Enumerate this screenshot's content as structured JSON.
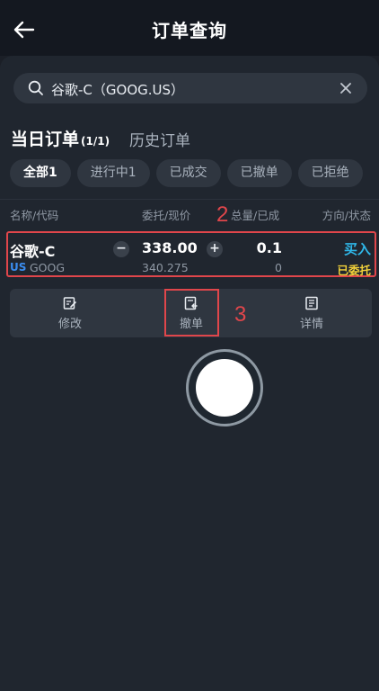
{
  "header": {
    "title": "订单查询"
  },
  "search": {
    "value": "谷歌-C（GOOG.US）"
  },
  "tabs": {
    "today_label": "当日订单",
    "today_count": "(1/1)",
    "history_label": "历史订单"
  },
  "filters": [
    "全部1",
    "进行中1",
    "已成交",
    "已撤单",
    "已拒绝"
  ],
  "columns": {
    "name": "名称/代码",
    "price": "委托/现价",
    "qty": "总量/已成",
    "dir": "方向/状态"
  },
  "annotations": {
    "row_marker": "2",
    "action_marker": "3"
  },
  "order": {
    "name": "谷歌-C",
    "market": "US",
    "code": "GOOG",
    "price": "338.00",
    "current": "340.275",
    "qty": "0.1",
    "filled": "0",
    "direction": "买入",
    "status": "已委托",
    "minus": "−",
    "plus": "+"
  },
  "actions": {
    "modify": "修改",
    "cancel": "撤单",
    "detail": "详情"
  },
  "colors": {
    "accent_blue": "#2fb7e8",
    "status_yellow": "#f3d23a",
    "market_blue": "#3b8df0",
    "highlight_red": "#e0464b"
  }
}
